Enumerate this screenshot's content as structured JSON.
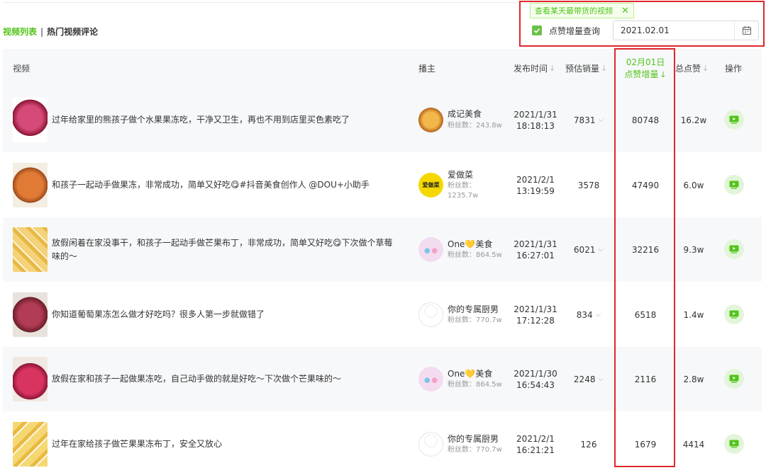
{
  "tabs": {
    "active": "视频列表",
    "separator": "|",
    "other": "热门视频评论"
  },
  "query": {
    "tooltip": "查看某天最带货的视频",
    "tooltip_close": "✕",
    "checkbox_label": "点赞增量查询",
    "checked": true,
    "date_value": "2021.02.01"
  },
  "columns": {
    "video": "视频",
    "anchor": "播主",
    "publish_time": "发布时间",
    "sales": "预估销量",
    "increment_date": "02月01日",
    "increment": "点赞增量",
    "total_likes": "总点赞",
    "action": "操作"
  },
  "sort_glyph": "↓",
  "chevron_glyph": "⌵",
  "colors": {
    "accent": "#52c41a",
    "highlight": "#e0262c",
    "stripe": "#f7f8fa"
  },
  "rows": [
    {
      "title": "过年给家里的熊孩子做个水果果冻吃，干净又卫生，再也不用到店里买色素吃了",
      "anchor": "成记美食",
      "fans": "粉丝数：243.8w",
      "date": "2021/1/31",
      "clock": "18:18:13",
      "sales": "7831",
      "increment": "80748",
      "total": "16.2w",
      "thumb": "#a7203f",
      "avatar": "#e8a340"
    },
    {
      "title": "和孩子一起动手做果冻，非常成功，简单又好吃😋#抖音美食创作人 @DOU+小助手",
      "anchor": "爱做菜",
      "fans_a": "粉丝数：",
      "fans_b": "1235.7w",
      "date": "2021/2/1",
      "clock": "13:19:59",
      "sales": "3578",
      "increment": "47490",
      "total": "6.0w",
      "thumb": "#d06a2a",
      "avatar": "#f5d800"
    },
    {
      "title": "放假闲着在家没事干，和孩子一起动手做芒果布丁，非常成功，简单又好吃😋下次做个草莓",
      "title2": "味的～",
      "anchor": "One💛美食",
      "fans": "粉丝数：864.5w",
      "date": "2021/1/31",
      "clock": "16:27:01",
      "sales": "6021",
      "increment": "32216",
      "total": "9.3w",
      "thumb": "#e9c46a",
      "avatar": "#f1d2e8"
    },
    {
      "title": "你知道葡萄果冻怎么做才好吃吗？很多人第一步就做错了",
      "anchor": "你的专属厨男",
      "fans": "粉丝数：770.7w",
      "date": "2021/1/31",
      "clock": "17:12:28",
      "sales": "834",
      "increment": "6518",
      "total": "1.4w",
      "thumb": "#8d2d3c",
      "avatar": "#f0f0f0"
    },
    {
      "title": "放假在家和孩子一起做果冻吃，自己动手做的就是好吃～下次做个芒果味的～",
      "anchor": "One💛美食",
      "fans": "粉丝数：864.5w",
      "date": "2021/1/30",
      "clock": "16:54:43",
      "sales": "2248",
      "increment": "2116",
      "total": "2.8w",
      "thumb": "#c0264d",
      "avatar": "#f1d2e8"
    },
    {
      "title": "过年在家给孩子做芒果果冻布丁，安全又放心",
      "anchor": "你的专属厨男",
      "fans": "粉丝数：770.7w",
      "date": "2021/2/1",
      "clock": "16:21:21",
      "sales": "126",
      "increment": "1679",
      "total": "4414",
      "thumb": "#efc85a",
      "avatar": "#f0f0f0"
    }
  ],
  "avatar_text_row2": "爱做菜"
}
